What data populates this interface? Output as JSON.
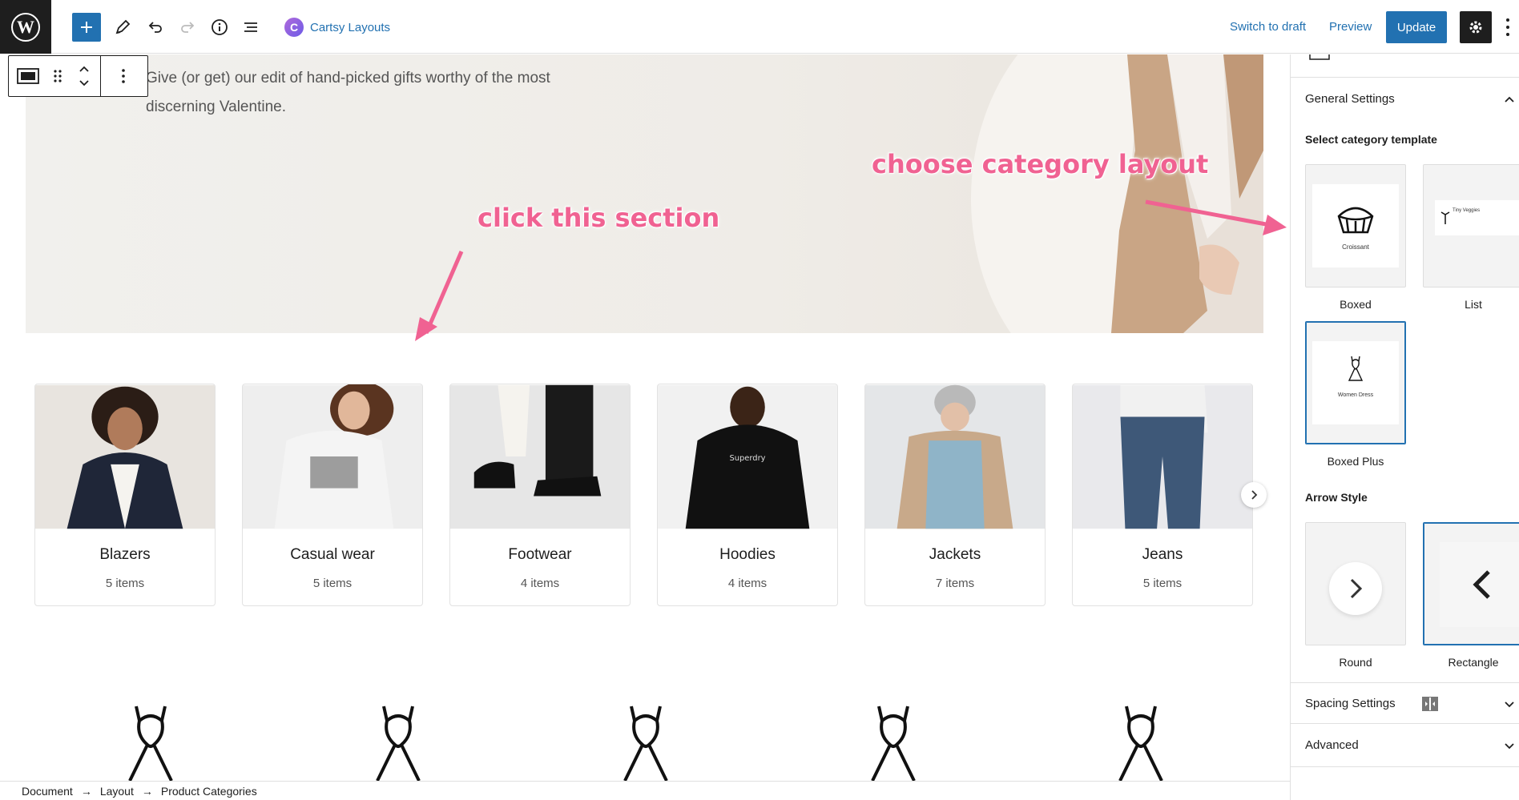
{
  "topbar": {
    "brand_name": "Cartsy Layouts",
    "switch_draft": "Switch to draft",
    "preview": "Preview",
    "update": "Update"
  },
  "hero": {
    "text": "Give (or get) our edit of hand-picked gifts worthy of the most discerning Valentine."
  },
  "annotations": {
    "click_section": "click this section",
    "choose_layout": "choose category layout"
  },
  "categories": [
    {
      "name": "Blazers",
      "count": "5 items"
    },
    {
      "name": "Casual wear",
      "count": "5 items"
    },
    {
      "name": "Footwear",
      "count": "4 items"
    },
    {
      "name": "Hoodies",
      "count": "4 items"
    },
    {
      "name": "Jackets",
      "count": "7 items"
    },
    {
      "name": "Jeans",
      "count": "5 items"
    }
  ],
  "breadcrumb": [
    "Document",
    "Layout",
    "Product Categories"
  ],
  "sidebar": {
    "general_settings": "General Settings",
    "select_template": "Select category template",
    "templates": [
      {
        "label": "Boxed",
        "preview_text": "Croissant"
      },
      {
        "label": "List",
        "preview_text": "Tiny Veggies"
      },
      {
        "label": "Boxed Plus",
        "preview_text": "Women Dress"
      }
    ],
    "arrow_style": "Arrow Style",
    "arrows": [
      {
        "label": "Round"
      },
      {
        "label": "Rectangle"
      }
    ],
    "spacing_settings": "Spacing Settings",
    "advanced": "Advanced"
  },
  "colors": {
    "accent": "#2271b1",
    "annotation": "#f06292",
    "dark": "#1e1e1e"
  }
}
